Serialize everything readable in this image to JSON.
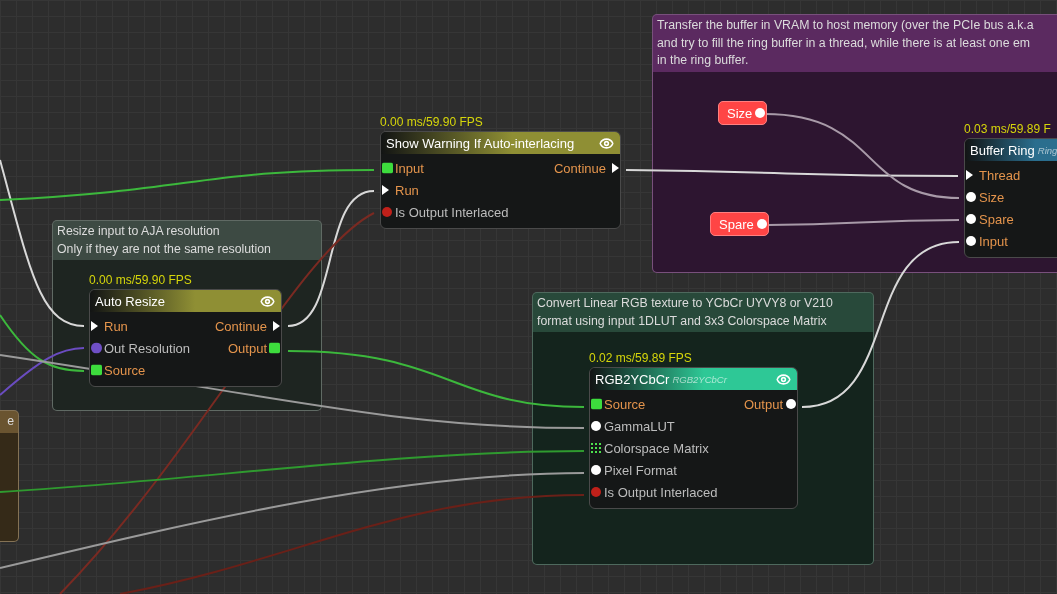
{
  "groups": [
    {
      "comment": "Transfer the buffer in VRAM to host memory (over the PCIe bus a.k.a\nand try to fill the ring buffer in a thread, while there is at least one em\nin the ring buffer.",
      "color": "#5b2a60"
    },
    {
      "comment": "Resize input to AJA resolution\nOnly if they are not the same resolution",
      "color": "#3d4a43"
    },
    {
      "comment": "Convert Linear RGB texture to YCbCr UYVY8 or V210\nformat using input 1DLUT and 3x3 Colorspace Matrix",
      "color": "#28493a"
    },
    {
      "comment": "e",
      "color": "#6a5430"
    }
  ],
  "nodes": [
    {
      "timing": "0.00 ms/59.90 FPS",
      "title": "Show Warning If Auto-interlacing",
      "color": "#8f8f34",
      "inputs": [
        {
          "label": "Input",
          "kind": "texture",
          "required": true
        },
        {
          "label": "Run",
          "kind": "exec",
          "required": true
        },
        {
          "label": "Is Output Interlaced",
          "kind": "bool",
          "required": false
        }
      ],
      "outputs": [
        {
          "label": "Continue",
          "kind": "exec",
          "required": true
        }
      ]
    },
    {
      "timing": "0.03 ms/59.89 F",
      "title": "Buffer Ring",
      "subtitle": "Ring",
      "color": "#2a6e8e",
      "inputs": [
        {
          "label": "Thread",
          "kind": "exec",
          "required": true
        },
        {
          "label": "Size",
          "kind": "data",
          "required": true
        },
        {
          "label": "Spare",
          "kind": "data",
          "required": true
        },
        {
          "label": "Input",
          "kind": "data",
          "required": true
        }
      ]
    },
    {
      "timing": "0.00 ms/59.90 FPS",
      "title": "Auto Resize",
      "color": "#8f8f34",
      "inputs": [
        {
          "label": "Run",
          "kind": "exec",
          "required": true
        },
        {
          "label": "Out Resolution",
          "kind": "enum",
          "required": false
        },
        {
          "label": "Source",
          "kind": "texture",
          "required": true
        }
      ],
      "outputs": [
        {
          "label": "Continue",
          "kind": "exec",
          "required": true
        },
        {
          "label": "Output",
          "kind": "texture",
          "required": true
        }
      ]
    },
    {
      "timing": "0.02 ms/59.89 FPS",
      "title": "RGB2YCbCr",
      "subtitle": "RGB2YCbCr",
      "color": "#2ec896",
      "inputs": [
        {
          "label": "Source",
          "kind": "texture",
          "required": true
        },
        {
          "label": "GammaLUT",
          "kind": "data",
          "required": false
        },
        {
          "label": "Colorspace Matrix",
          "kind": "matrix",
          "required": false
        },
        {
          "label": "Pixel Format",
          "kind": "data",
          "required": false
        },
        {
          "label": "Is Output Interlaced",
          "kind": "bool",
          "required": false
        }
      ],
      "outputs": [
        {
          "label": "Output",
          "kind": "data",
          "required": true
        }
      ]
    }
  ],
  "variables": [
    {
      "label": "Size"
    },
    {
      "label": "Spare"
    }
  ]
}
